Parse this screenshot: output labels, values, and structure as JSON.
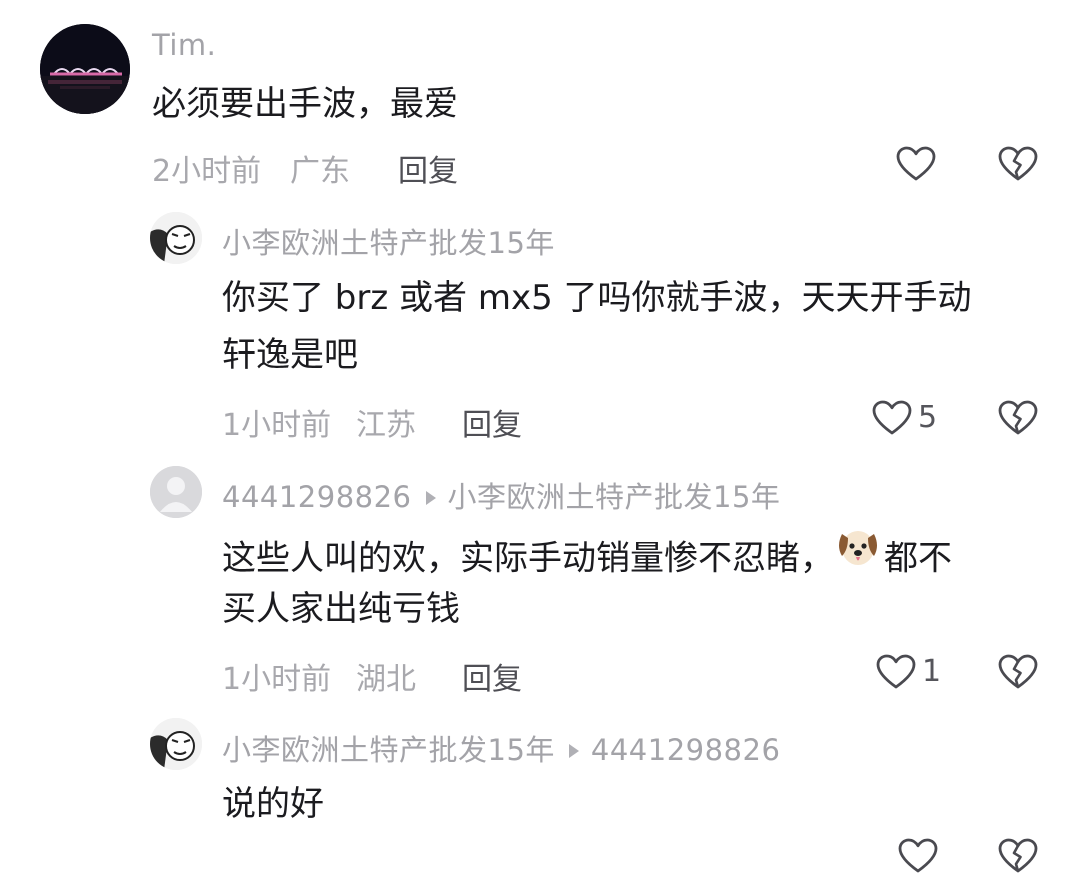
{
  "comments": [
    {
      "username": "Tim.",
      "text_lines": [
        "必须要出手波，最爱"
      ],
      "time": "2小时前",
      "location": "广东",
      "reply_label": "回复",
      "likes": ""
    },
    {
      "username": "小李欧洲土特产批发15年",
      "text_lines": [
        "你买了 brz 或者 mx5 了吗你就手波，天天开手动",
        "轩逸是吧"
      ],
      "time": "1小时前",
      "location": "江苏",
      "reply_label": "回复",
      "likes": "5"
    },
    {
      "username": "4441298826",
      "reply_to": "小李欧洲土特产批发15年",
      "text_lines": [
        "这些人叫的欢，实际手动销量惨不忍睹，",
        "都不",
        "买人家出纯亏钱"
      ],
      "time": "1小时前",
      "location": "湖北",
      "reply_label": "回复",
      "likes": "1"
    },
    {
      "username": "小李欧洲土特产批发15年",
      "reply_to": "4441298826",
      "text_lines": [
        "说的好"
      ]
    }
  ],
  "icons": {
    "like": "heart-outline-icon",
    "dislike": "broken-heart-icon",
    "emoji": "dog-face-emoji"
  },
  "colors": {
    "text": "#1b1b1f",
    "meta": "#a8a8ad",
    "icon": "#4a4a50"
  }
}
